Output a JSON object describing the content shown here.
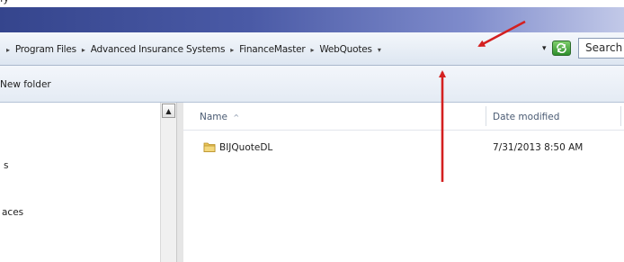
{
  "window": {
    "top_strip_text": "ly"
  },
  "address_bar": {
    "breadcrumb": [
      "Program Files",
      "Advanced Insurance Systems",
      "FinanceMaster",
      "WebQuotes"
    ],
    "separator_glyph": "▸",
    "dropdown_glyph": "▾",
    "search_placeholder": "Search"
  },
  "toolbar": {
    "new_folder_label": "New folder"
  },
  "nav_pane": {
    "items": [
      "s",
      "aces"
    ]
  },
  "file_list": {
    "columns": {
      "name": "Name",
      "name_sort_glyph": "^",
      "date_modified": "Date modified"
    },
    "rows": [
      {
        "name": "BIJQuoteDL",
        "date_modified": "7/31/2013 8:50 AM",
        "icon": "folder-icon"
      }
    ]
  },
  "annotations": {
    "arrow_color": "#d42020",
    "count": 2
  },
  "colors": {
    "titlebar_start": "#35458d",
    "refresh_green": "#2f8f2c",
    "folder_yellow": "#e8c45a"
  }
}
